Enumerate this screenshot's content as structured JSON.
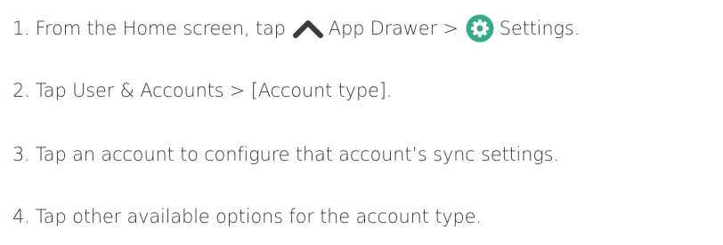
{
  "steps": [
    {
      "number": "1.",
      "text_before": "From the Home screen, tap",
      "icon1": "chevron-up-icon",
      "label1": "App Drawer >",
      "icon2": "gear-icon",
      "label2": "Settings."
    },
    {
      "number": "2.",
      "text": "Tap User & Accounts > [Account type]."
    },
    {
      "number": "3.",
      "text": "Tap an account to configure that account’s sync settings."
    },
    {
      "number": "4.",
      "text": "Tap other available options for the account type."
    }
  ],
  "colors": {
    "text": "#3a3a3a",
    "chevron": "#3c3c3c",
    "gear_bg": "#2fae8e",
    "gear_fg": "#ffffff"
  }
}
